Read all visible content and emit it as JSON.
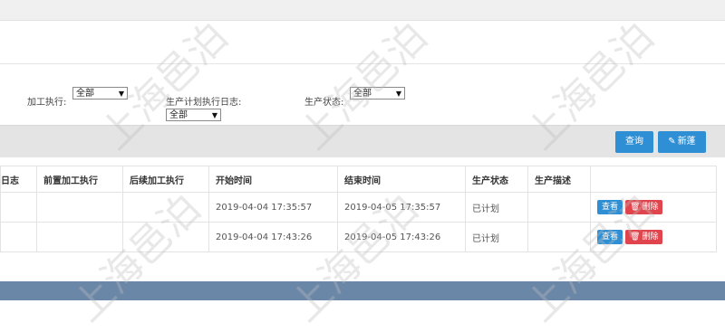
{
  "filters": {
    "process_exec": {
      "label": "加工执行:",
      "value": "全部"
    },
    "plan_log": {
      "label": "生产计划执行日志:",
      "value": "全部"
    },
    "status": {
      "label": "生产状态:",
      "value": "全部"
    }
  },
  "toolbar": {
    "query_label": "查询",
    "new_label": "新蓬"
  },
  "table": {
    "headers": [
      "日志",
      "前置加工执行",
      "后续加工执行",
      "开始时间",
      "结束时间",
      "生产状态",
      "生产描述",
      ""
    ],
    "rows": [
      {
        "start": "2019-04-04 17:35:57",
        "end": "2019-04-05 17:35:57",
        "status": "已计划",
        "desc": ""
      },
      {
        "start": "2019-04-04 17:43:26",
        "end": "2019-04-05 17:43:26",
        "status": "已计划",
        "desc": ""
      }
    ],
    "view_label": "查看",
    "delete_label": "删除"
  },
  "watermark_text": "上海邑泊",
  "colors": {
    "primary": "#2f8fd5",
    "danger": "#e0454e",
    "footer": "#6b87a8"
  }
}
